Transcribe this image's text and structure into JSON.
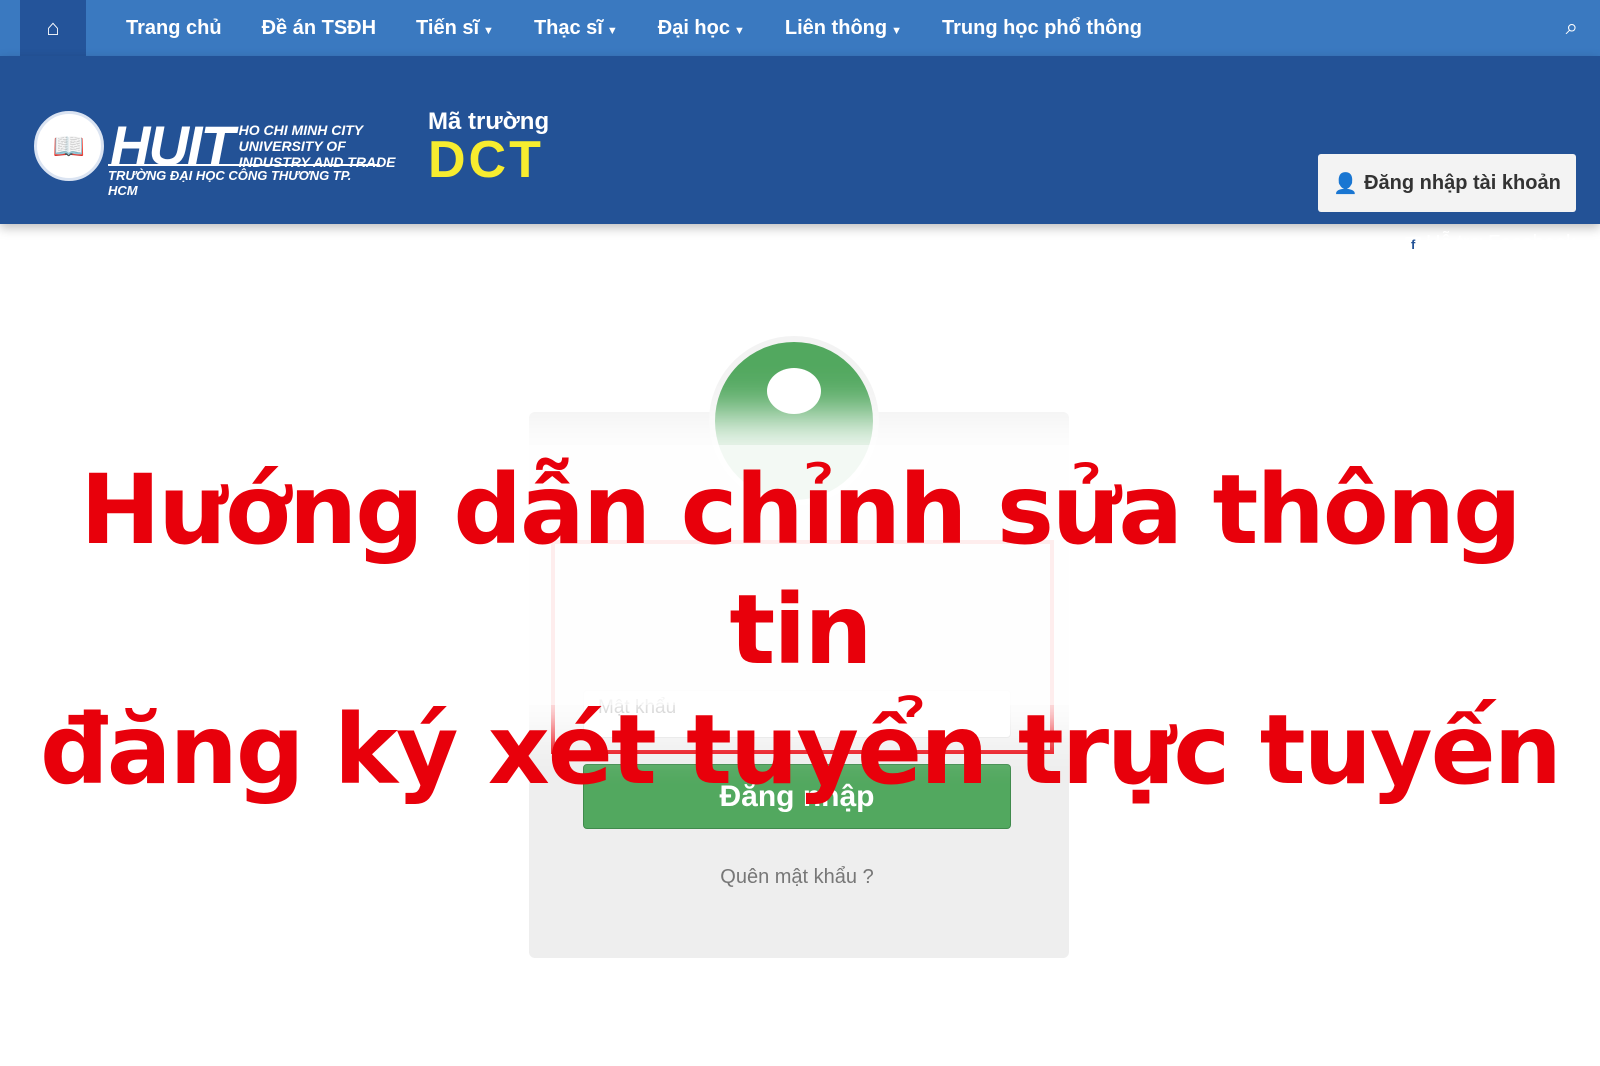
{
  "nav": {
    "home_icon": "home-icon",
    "items": [
      {
        "label": "Trang chủ",
        "dropdown": false
      },
      {
        "label": "Đề án TSĐH",
        "dropdown": false
      },
      {
        "label": "Tiến sĩ",
        "dropdown": true
      },
      {
        "label": "Thạc sĩ",
        "dropdown": true
      },
      {
        "label": "Đại học",
        "dropdown": true
      },
      {
        "label": "Liên thông",
        "dropdown": true
      },
      {
        "label": "Trung học phổ thông",
        "dropdown": false
      }
    ],
    "search_icon": "search-icon"
  },
  "header": {
    "logo_main": "HUIT",
    "logo_sub": [
      "HO CHI MINH CITY",
      "UNIVERSITY OF",
      "INDUSTRY AND TRADE"
    ],
    "logo_tagline": "TRƯỜNG ĐẠI HỌC CÔNG THƯƠNG TP. HCM",
    "code_label": "Mã trường",
    "code_value": "DCT",
    "login_button": "Đăng nhập tài khoản",
    "facebook_link": "Hỗ trợ Facebook"
  },
  "login": {
    "password_placeholder": "Mật khẩu",
    "submit": "Đăng nhập",
    "forgot": "Quên mật khẩu ?"
  },
  "overlay": {
    "line1": "Hướng dẫn chỉnh sửa thông tin",
    "line2": "đăng ký xét tuyển trực tuyến"
  },
  "colors": {
    "nav": "#3a79c0",
    "header": "#235296",
    "accent_green": "#52a85f",
    "title_red": "#e8000b",
    "code_yellow": "#f7ec2f"
  }
}
